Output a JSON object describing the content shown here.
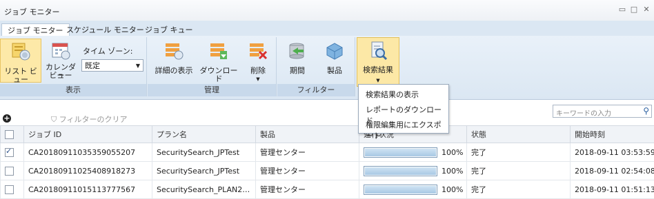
{
  "window": {
    "title": "ジョブ モニター",
    "controls": [
      "minimize-icon",
      "maximize-icon",
      "close-icon"
    ]
  },
  "tabs": [
    {
      "label": "ジョブ モニター",
      "active": true
    },
    {
      "label": "スケジュール モニター",
      "active": false
    },
    {
      "label": "ジョブ キュー",
      "active": false
    }
  ],
  "ribbon": {
    "display": {
      "label": "表示",
      "list_view": "リスト ビュー",
      "calendar_view_l1": "カレンダー",
      "calendar_view_l2": "ビュー",
      "timezone_label": "タイム ゾーン:",
      "timezone_value": "既定"
    },
    "manage": {
      "label": "管理",
      "details": "詳細の表示",
      "download": "ダウンロード",
      "delete": "削除"
    },
    "filter": {
      "label": "フィルター",
      "period": "期間",
      "product": "製品"
    },
    "search_results": "検索結果"
  },
  "dropdown_menu": [
    "検索結果の表示",
    "レポートのダウンロード",
    "権限編集用にエクスポート"
  ],
  "toolbar": {
    "clear_filter": "フィルターのクリア",
    "search_placeholder": "キーワードの入力"
  },
  "table": {
    "columns": [
      "ジョブ ID",
      "プラン名",
      "製品",
      "進行状況",
      "状態",
      "開始時刻"
    ],
    "rows": [
      {
        "checked": true,
        "job_id": "CA20180911035359055207",
        "plan": "SecuritySearch_JPTest",
        "product": "管理センター",
        "progress": 1.0,
        "progress_text": "100%",
        "status": "完了",
        "start": "2018-09-11 03:53:59"
      },
      {
        "checked": false,
        "job_id": "CA20180911025408918273",
        "plan": "SecuritySearch_JPTest",
        "product": "管理センター",
        "progress": 1.0,
        "progress_text": "100%",
        "status": "完了",
        "start": "2018-09-11 02:54:08"
      },
      {
        "checked": false,
        "job_id": "CA20180911015113777567",
        "plan": "SecuritySearch_PLAN2…",
        "product": "管理センター",
        "progress": 1.0,
        "progress_text": "100%",
        "status": "完了",
        "start": "2018-09-11 01:51:13"
      }
    ]
  }
}
